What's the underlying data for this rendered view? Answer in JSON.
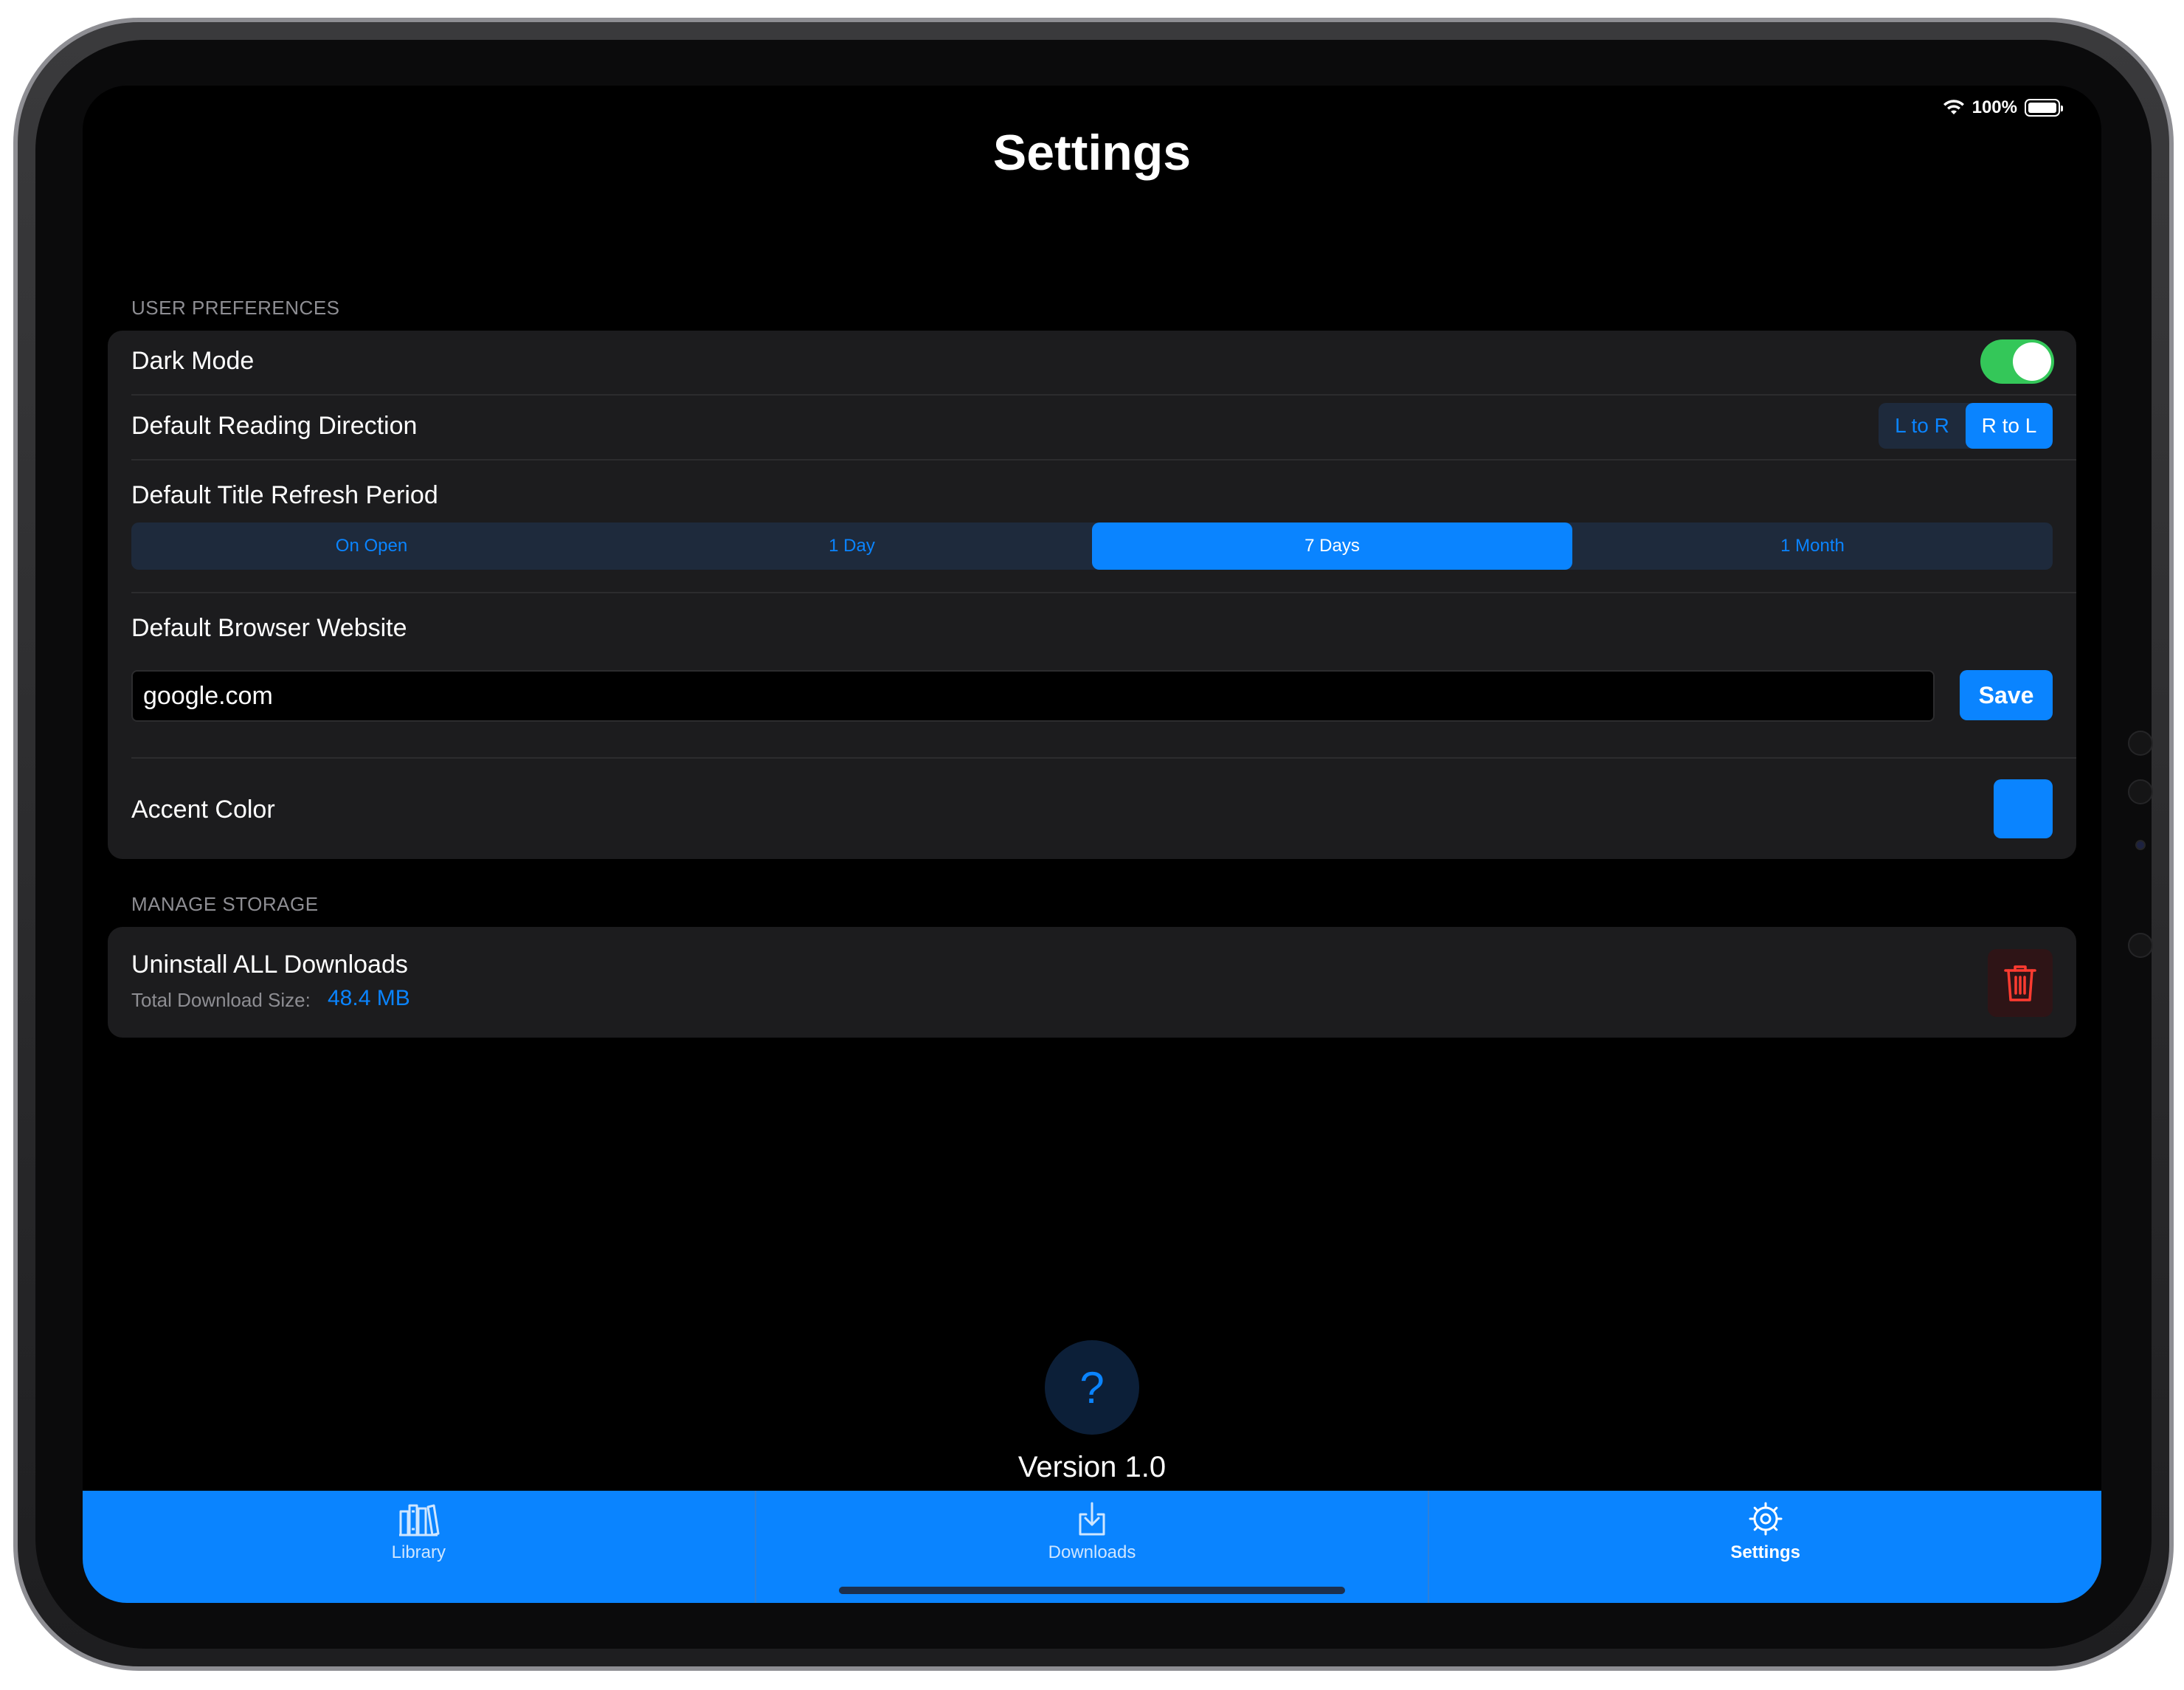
{
  "status_bar": {
    "battery_percent": "100%"
  },
  "title": "Settings",
  "user_preferences": {
    "header": "USER PREFERENCES",
    "dark_mode": {
      "label": "Dark Mode",
      "enabled": true
    },
    "reading_direction": {
      "label": "Default Reading Direction",
      "options": [
        "L to R",
        "R to L"
      ],
      "selected": "R to L"
    },
    "refresh_period": {
      "label": "Default Title Refresh Period",
      "options": [
        "On Open",
        "1 Day",
        "7 Days",
        "1 Month"
      ],
      "selected": "7 Days"
    },
    "browser_website": {
      "label": "Default Browser Website",
      "value": "google.com",
      "save_label": "Save"
    },
    "accent_color": {
      "label": "Accent Color",
      "color": "#0a84ff"
    }
  },
  "manage_storage": {
    "header": "MANAGE STORAGE",
    "uninstall": {
      "label": "Uninstall ALL Downloads",
      "size_label": "Total Download Size:",
      "size_value": "48.4 MB"
    }
  },
  "help": {
    "icon": "question-mark-icon",
    "glyph": "?"
  },
  "version": "Version 1.0",
  "tabs": [
    {
      "label": "Library",
      "icon": "library-icon",
      "selected": false
    },
    {
      "label": "Downloads",
      "icon": "download-icon",
      "selected": false
    },
    {
      "label": "Settings",
      "icon": "gear-icon",
      "selected": true
    }
  ],
  "colors": {
    "accent": "#0a84ff",
    "toggle_on": "#34c759",
    "destructive": "#ff3b30",
    "background": "#000000",
    "card": "#1c1c1e"
  }
}
